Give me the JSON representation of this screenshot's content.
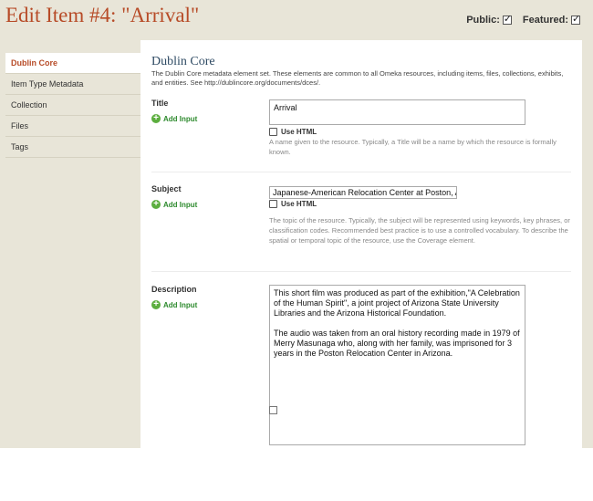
{
  "header": {
    "title": "Edit Item #4: \"Arrival\"",
    "public_label": "Public:",
    "featured_label": "Featured:",
    "public_checked": true,
    "featured_checked": true
  },
  "sidebar": {
    "items": [
      {
        "label": "Dublin Core",
        "active": true
      },
      {
        "label": "Item Type Metadata",
        "active": false
      },
      {
        "label": "Collection",
        "active": false
      },
      {
        "label": "Files",
        "active": false
      },
      {
        "label": "Tags",
        "active": false
      }
    ]
  },
  "main": {
    "section_title": "Dublin Core",
    "section_description": "The Dublin Core metadata element set. These elements are common to all Omeka resources, including items, files, collections, exhibits, and entities. See http://dublincore.org/documents/dces/.",
    "add_input_label": "Add Input",
    "use_html_label": "Use HTML",
    "fields": {
      "title": {
        "label": "Title",
        "value": "Arrival",
        "help": "A name given to the resource. Typically, a Title will be a name by which the resource is formally known."
      },
      "subject": {
        "label": "Subject",
        "value": "Japanese-American Relocation Center at Poston, A",
        "help": "The topic of the resource. Typically, the subject will be represented using keywords, key phrases, or classification codes. Recommended best practice is to use a controlled vocabulary. To describe the spatial or temporal topic of the resource, use the Coverage element."
      },
      "description": {
        "label": "Description",
        "value": "This short film was produced as part of the exhibition,\"A Celebration of the Human Spirit\", a joint project of Arizona State University Libraries and the Arizona Historical Foundation.\n\nThe audio was taken from an oral history recording made in 1979 of Merry Masunaga who, along with her family, was imprisoned for 3 years in the Poston Relocation Center in Arizona."
      }
    }
  },
  "colors": {
    "title": "#b74b27",
    "background": "#e8e5d8",
    "section_heading": "#2e4a63",
    "add_input": "#2d8a2d"
  }
}
